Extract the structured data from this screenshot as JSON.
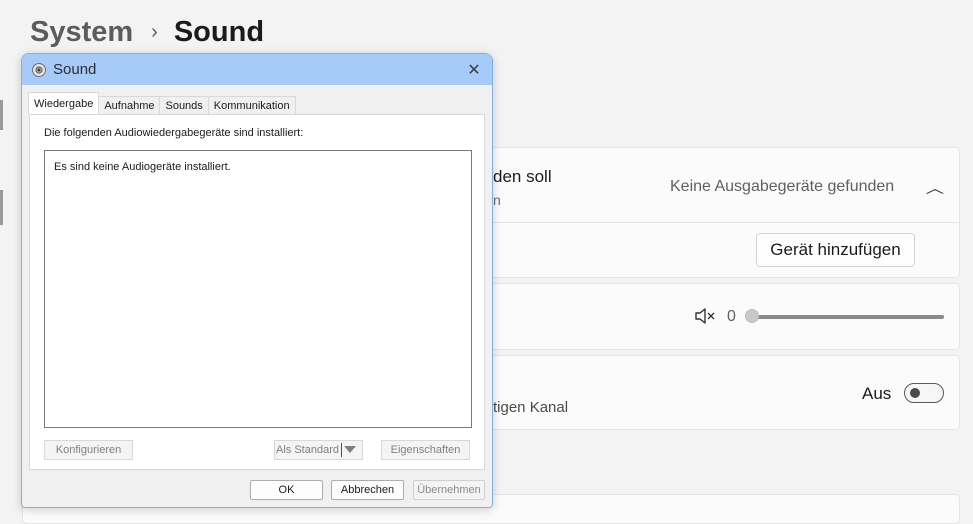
{
  "breadcrumb": {
    "parent": "System",
    "separator": "›",
    "current": "Sound"
  },
  "settings": {
    "output_title_fragment": "den soll",
    "output_subtitle_fragment": "n",
    "output_value": "Keine Ausgabegeräte gefunden",
    "add_device_label": "Gerät hinzufügen",
    "volume_value": "0",
    "volume_level": 0,
    "mono_subtitle_fragment": "tigen Kanal",
    "toggle_label": "Aus",
    "toggle_on": false
  },
  "dialog": {
    "title": "Sound",
    "tabs": [
      {
        "label": "Wiedergabe",
        "active": true
      },
      {
        "label": "Aufnahme",
        "active": false
      },
      {
        "label": "Sounds",
        "active": false
      },
      {
        "label": "Kommunikation",
        "active": false
      }
    ],
    "instruction": "Die folgenden Audiowiedergabegeräte sind installiert:",
    "empty_message": "Es sind keine Audiogeräte installiert.",
    "configure_label": "Konfigurieren",
    "set_default_label": "Als Standard",
    "properties_label": "Eigenschaften",
    "ok_label": "OK",
    "cancel_label": "Abbrechen",
    "apply_label": "Übernehmen"
  },
  "colors": {
    "titlebar": "#a7cbf9",
    "background": "#f3f3f3",
    "card": "#fbfbfb"
  },
  "icons": [
    "speaker-icon",
    "close-icon",
    "chevron-up-icon",
    "mute-icon",
    "dropdown-arrow-icon"
  ]
}
